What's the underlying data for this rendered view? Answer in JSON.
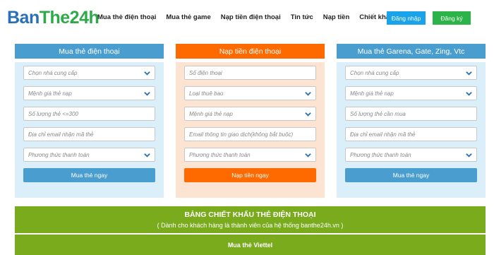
{
  "header": {
    "logo": {
      "part1": "Ban",
      "part2": "The24h"
    },
    "nav": [
      "Mua thẻ điện thoại",
      "Mua thẻ game",
      "Nạp tiền điện thoại",
      "Tin tức",
      "Nạp tiền",
      "Chiết khấu"
    ],
    "login": "Đăng nhập",
    "register": "Đăng ký",
    "colors": {
      "login": "#1aa3e8",
      "register": "#2cb34a"
    }
  },
  "panels": [
    {
      "title": "Mua thẻ điện thoại",
      "fields": [
        "Chọn nhà cung cấp",
        "Mệnh giá thẻ nạp",
        "Số lượng thẻ <=300",
        "Địa chỉ email nhận mã thẻ",
        "Phương thức thanh toán"
      ],
      "button": "Mua thẻ ngay"
    },
    {
      "title": "Nạp tiền điện thoại",
      "fields": [
        "Số điện thoại",
        "Loại thuê bao",
        "Mệnh giá thẻ nạp",
        "Email thông tin giao dịch(không bắt buộc)",
        "Phương thức thanh toán"
      ],
      "button": "Nạp tiền ngay"
    },
    {
      "title": "Mua thẻ Garena, Gate, Zing, Vtc",
      "fields": [
        "Chọn nhà cung cấp",
        "Mệnh giá thẻ nạp",
        "Số lượng thẻ cần mua",
        "Địa chỉ email nhận mã thẻ",
        "Phương thức thanh toán"
      ],
      "button": "Mua thẻ ngay"
    }
  ],
  "discount": {
    "title": "BẢNG CHIẾT KHẤU THẺ ĐIỆN THOẠI",
    "subtitle": "( Dành cho khách hàng là thành viên của hệ thống banthe24h.vn )",
    "section": "Mua thẻ Viettel"
  },
  "colors": {
    "blue": "#4a9ecf",
    "orange": "#ff6a00",
    "green": "#79ab1d"
  }
}
